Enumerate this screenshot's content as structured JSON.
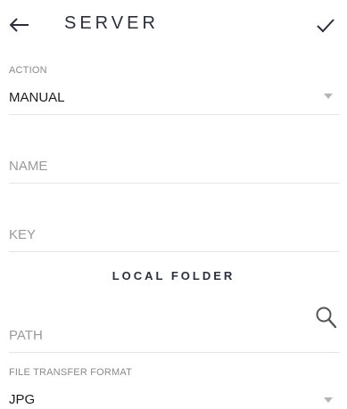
{
  "header": {
    "title": "SERVER",
    "back_icon": "arrow-left-icon",
    "confirm_icon": "check-icon"
  },
  "action": {
    "caption": "ACTION",
    "value": "MANUAL",
    "dropdown_icon": "caret-down-icon"
  },
  "name": {
    "placeholder": "NAME"
  },
  "key": {
    "placeholder": "KEY"
  },
  "local_folder": {
    "title": "LOCAL FOLDER",
    "path_placeholder": "PATH",
    "search_icon": "search-icon"
  },
  "file_transfer": {
    "caption": "FILE TRANSFER FORMAT",
    "value": "JPG",
    "dropdown_icon": "caret-down-icon"
  }
}
